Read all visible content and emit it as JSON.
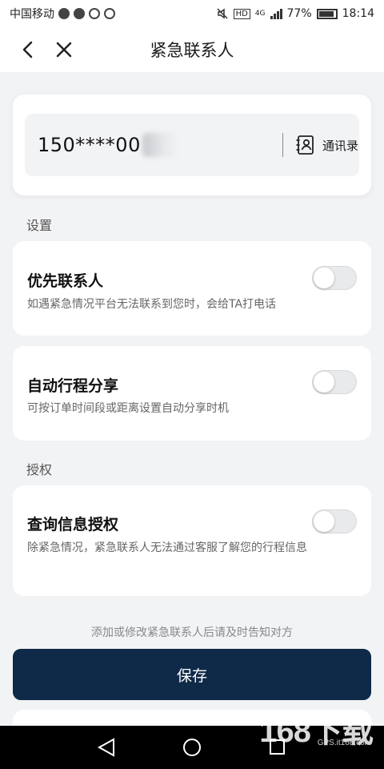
{
  "status_bar": {
    "carrier": "中国移动",
    "network": "4G",
    "hd": "HD",
    "battery": "77%",
    "time": "18:14"
  },
  "nav": {
    "title": "紧急联系人"
  },
  "phone": {
    "number": "150****00",
    "contacts_label": "通讯录"
  },
  "sections": {
    "settings": "设置",
    "authorization": "授权"
  },
  "settings": [
    {
      "title": "优先联系人",
      "desc": "如遇紧急情况平台无法联系到您时，会给TA打电话",
      "enabled": false
    },
    {
      "title": "自动行程分享",
      "desc": "可按订单时间段或距离设置自动分享时机",
      "enabled": false
    },
    {
      "title": "查询信息授权",
      "desc": "除紧急情况，紧急联系人无法通过客服了解您的行程信息",
      "enabled": false
    }
  ],
  "footer": {
    "hint": "添加或修改紧急联系人后请及时告知对方",
    "save_label": "保存"
  },
  "watermark": {
    "logo": "168下载",
    "site": "GPS.it168.com"
  }
}
